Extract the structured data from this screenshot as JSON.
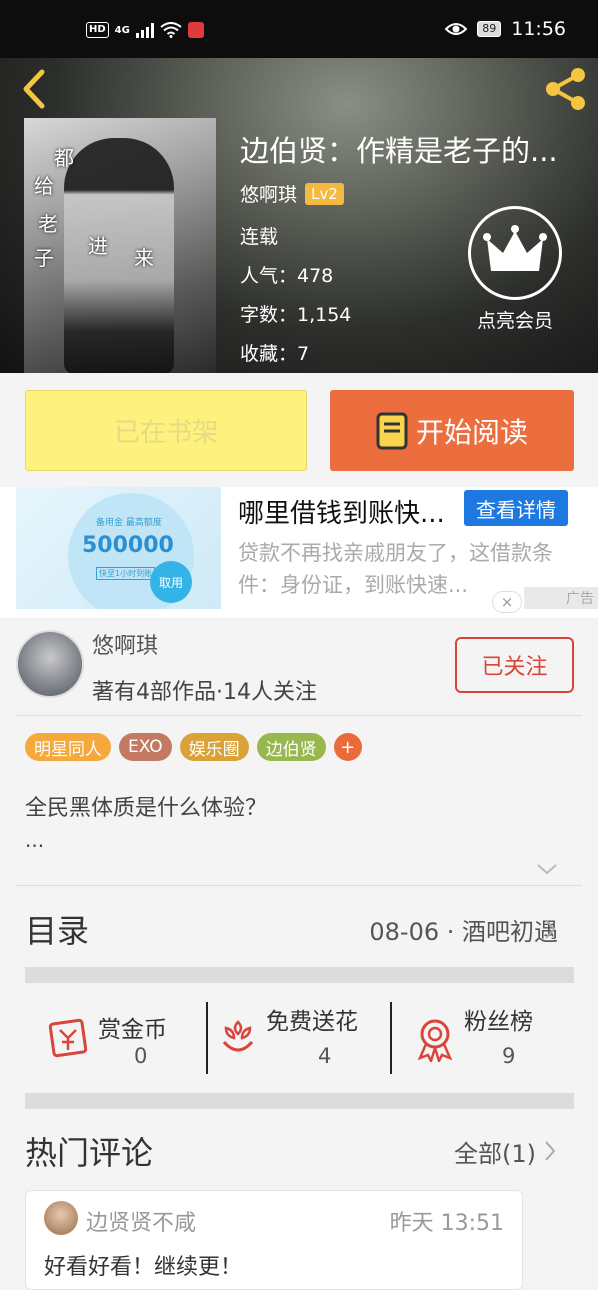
{
  "status_bar": {
    "network_badge": "HD",
    "signal": "4G",
    "eye_icon": "eye-icon",
    "battery": "89",
    "time": "11:56"
  },
  "book": {
    "title": "边伯贤：作精是老子的...",
    "author": "悠啊琪",
    "level": "Lv2",
    "status": "连载",
    "popularity": "人气：478",
    "word_count": "字数：1,154",
    "favorites": "收藏：7",
    "cover_text": [
      "都",
      "给",
      "老",
      "子",
      "进",
      "来"
    ]
  },
  "vip": {
    "label": "点亮会员"
  },
  "actions": {
    "shelf_label": "已在书架",
    "read_label": "开始阅读"
  },
  "ad": {
    "title": "哪里借钱到账快...",
    "button": "查看详情",
    "description": "贷款不再找亲戚朋友了，这借款条件：身份证，到账快速...",
    "label": "广告",
    "image_caption_top": "备用金 最高额度",
    "image_amount": "500000",
    "image_caption_bottom": "快至1小时到账",
    "image_button": "取用",
    "close": "×"
  },
  "author_card": {
    "name": "悠啊琪",
    "stats": "著有4部作品·14人关注",
    "follow_label": "已关注"
  },
  "tags": [
    {
      "label": "明星同人",
      "color": "#f5a93c"
    },
    {
      "label": "EXO",
      "color": "#c27a62"
    },
    {
      "label": "娱乐圈",
      "color": "#d9a33a"
    },
    {
      "label": "边伯贤",
      "color": "#97b84e"
    }
  ],
  "tag_more": "+",
  "summary": {
    "text": "全民黑体质是什么体验？",
    "ellipsis": "..."
  },
  "catalog": {
    "title": "目录",
    "latest": "08-06 · 酒吧初遇"
  },
  "stats": [
    {
      "label": "赏金币",
      "value": "0",
      "icon": "red-envelope-icon"
    },
    {
      "label": "免费送花",
      "value": "4",
      "icon": "flower-icon"
    },
    {
      "label": "粉丝榜",
      "value": "9",
      "icon": "medal-icon"
    }
  ],
  "comments": {
    "title": "热门评论",
    "all_label": "全部(1)",
    "items": [
      {
        "user": "边贤贤不咸",
        "time": "昨天 13:51",
        "text": "好看好看！继续更！"
      }
    ]
  },
  "colors": {
    "accent_orange": "#ec6d3d",
    "shelf_yellow": "#fff17d",
    "follow_red": "#d9453a",
    "ad_blue": "#1d79e0",
    "icon_yellow": "#f5c542"
  }
}
